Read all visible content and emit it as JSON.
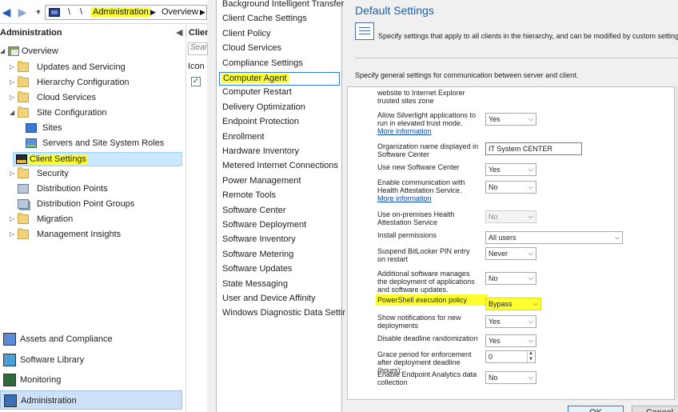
{
  "addressbar": {
    "back_icon": "back-arrow-icon",
    "forward_icon": "forward-arrow-icon",
    "separator1": "\\",
    "separator2": "\\",
    "crumb_admin": "Administration",
    "crumb_arrow": "▶",
    "crumb_overview": "Overview",
    "crumb_arrow2": "▶"
  },
  "workspace": {
    "title": "Administration",
    "collapse": "◀"
  },
  "tree": [
    {
      "label": "Overview",
      "icon": "overview-icon",
      "expander": "◢"
    },
    {
      "label": "Updates and Servicing",
      "icon": "folder-icon",
      "expander": "▷"
    },
    {
      "label": "Hierarchy Configuration",
      "icon": "folder-icon",
      "expander": "▷"
    },
    {
      "label": "Cloud Services",
      "icon": "folder-icon",
      "expander": "▷"
    },
    {
      "label": "Site Configuration",
      "icon": "folder-icon",
      "expander": "◢"
    },
    {
      "label": "Sites",
      "icon": "sites-icon",
      "expander": ""
    },
    {
      "label": "Servers and Site System Roles",
      "icon": "server-icon",
      "expander": ""
    },
    {
      "label": "Client Settings",
      "icon": "client-settings-icon",
      "expander": ""
    },
    {
      "label": "Security",
      "icon": "folder-icon",
      "expander": "▷"
    },
    {
      "label": "Distribution Points",
      "icon": "distribution-point-icon",
      "expander": ""
    },
    {
      "label": "Distribution Point Groups",
      "icon": "distribution-group-icon",
      "expander": ""
    },
    {
      "label": "Migration",
      "icon": "folder-icon",
      "expander": "▷"
    },
    {
      "label": "Management Insights",
      "icon": "folder-icon",
      "expander": "▷"
    }
  ],
  "workspaces": [
    {
      "label": "Assets and Compliance",
      "icon": "assets-icon"
    },
    {
      "label": "Software Library",
      "icon": "library-icon"
    },
    {
      "label": "Monitoring",
      "icon": "monitoring-icon"
    },
    {
      "label": "Administration",
      "icon": "administration-icon"
    }
  ],
  "list_column": {
    "title": "Client",
    "search_placeholder": "Search",
    "header": "Icon",
    "check": "✓"
  },
  "settings_list": [
    "Background Intelligent Transfer",
    "Client Cache Settings",
    "Client Policy",
    "Cloud Services",
    "Compliance Settings",
    "Computer Agent",
    "Computer Restart",
    "Delivery Optimization",
    "Endpoint Protection",
    "Enrollment",
    "Hardware Inventory",
    "Metered Internet Connections",
    "Power Management",
    "Remote Tools",
    "Software Center",
    "Software Deployment",
    "Software Inventory",
    "Software Metering",
    "Software Updates",
    "State Messaging",
    "User and Device Affinity",
    "Windows Diagnostic Data Settings"
  ],
  "right": {
    "title": "Default Settings",
    "description": "Specify settings that apply to all clients in the hierarchy, and can be modified by custom settings.",
    "sub_description": "Specify general settings for communication between server and client.",
    "ok": "OK",
    "cancel": "Cancel"
  },
  "properties": [
    {
      "label": "website to Internet Explorer trusted sites zone",
      "link": "",
      "value": "",
      "type": "none"
    },
    {
      "label": "Allow Silverlight applications to run in elevated trust mode.",
      "link": "More information",
      "value": "Yes",
      "type": "select"
    },
    {
      "label": "Organization name displayed in Software Center",
      "link": "",
      "value": "IT System CENTER",
      "type": "text"
    },
    {
      "label": "Use new Software Center",
      "link": "",
      "value": "Yes",
      "type": "select"
    },
    {
      "label": "Enable communication with Health Attestation Service.",
      "link": "More information",
      "value": "No",
      "type": "select"
    },
    {
      "label": "Use on-premises Health Attestation Service",
      "link": "",
      "value": "No",
      "type": "disabled"
    },
    {
      "label": "Install permissions",
      "link": "",
      "value": "All users",
      "type": "select-wide"
    },
    {
      "label": "Suspend BitLocker PIN entry on restart",
      "link": "",
      "value": "Never",
      "type": "select"
    },
    {
      "label": "Additional software manages the deployment of applications and software updates.",
      "link": "",
      "value": "No",
      "type": "select"
    },
    {
      "label": "PowerShell execution policy",
      "link": "",
      "value": "Bypass",
      "type": "select"
    },
    {
      "label": "Show notifications for new deployments",
      "link": "",
      "value": "Yes",
      "type": "select"
    },
    {
      "label": "Disable deadline randomization",
      "link": "",
      "value": "Yes",
      "type": "select"
    },
    {
      "label": "Grace period for enforcement after deployment deadline (hours):",
      "link": "",
      "value": "0",
      "type": "spin"
    },
    {
      "label": "Enable Endpoint Analytics data collection",
      "link": "",
      "value": "No",
      "type": "select"
    }
  ],
  "colors": {
    "highlight": "#ffff30",
    "title_blue": "#1a5fb4",
    "selection_border": "#2f7bd7"
  }
}
